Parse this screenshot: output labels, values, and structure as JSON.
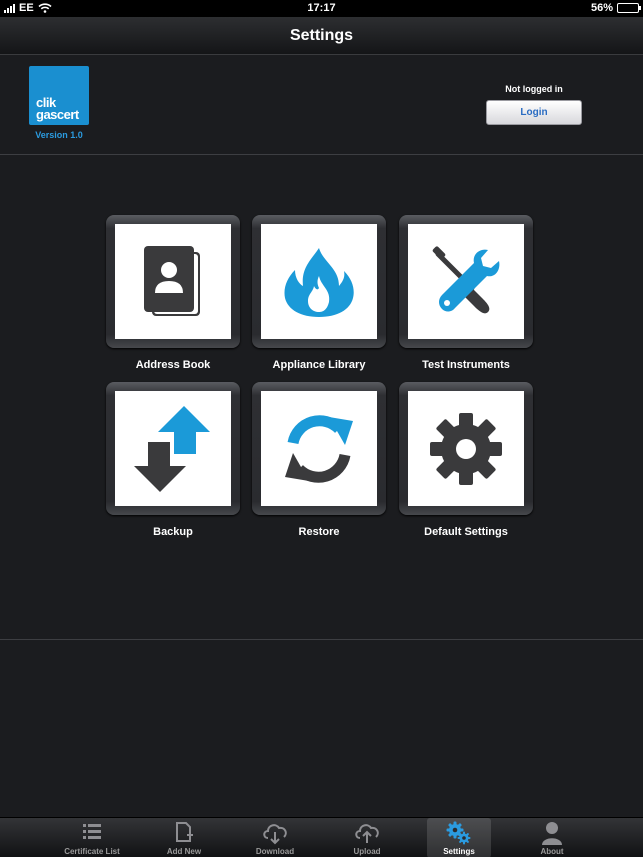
{
  "status_bar": {
    "carrier": "EE",
    "time": "17:17",
    "battery_percent": "56%",
    "battery_level": 0.56
  },
  "nav": {
    "title": "Settings"
  },
  "header": {
    "logo_line1": "clik",
    "logo_line2": "gascert",
    "version": "Version 1.0",
    "login_status": "Not logged in",
    "login_button": "Login"
  },
  "tiles": [
    {
      "label": "Address Book",
      "icon": "address-book-icon"
    },
    {
      "label": "Appliance Library",
      "icon": "flame-icon"
    },
    {
      "label": "Test Instruments",
      "icon": "tools-icon"
    },
    {
      "label": "Backup",
      "icon": "backup-arrows-icon"
    },
    {
      "label": "Restore",
      "icon": "refresh-icon"
    },
    {
      "label": "Default Settings",
      "icon": "gear-icon"
    }
  ],
  "tabs": [
    {
      "label": "Certificate List",
      "icon": "list-icon",
      "active": false
    },
    {
      "label": "Add New",
      "icon": "new-document-icon",
      "active": false
    },
    {
      "label": "Download",
      "icon": "cloud-download-icon",
      "active": false
    },
    {
      "label": "Upload",
      "icon": "cloud-upload-icon",
      "active": false
    },
    {
      "label": "Settings",
      "icon": "gears-icon",
      "active": true
    },
    {
      "label": "About",
      "icon": "person-icon",
      "active": false
    }
  ],
  "colors": {
    "accent": "#2b9be0",
    "background": "#1b1c1f",
    "icon_blue": "#1b9ad8",
    "icon_dark": "#3a3a3c"
  }
}
